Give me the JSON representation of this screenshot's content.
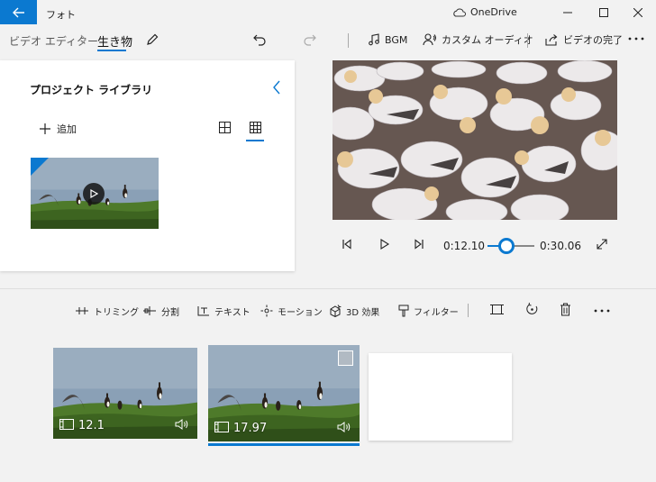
{
  "window": {
    "app_title": "フォト",
    "cloud_label": "OneDrive"
  },
  "toolbar": {
    "breadcrumb_root": "ビデオ エディター",
    "breadcrumb_current": "生き物",
    "bgm_label": "BGM",
    "custom_audio_label": "カスタム オーディオ",
    "finish_video_label": "ビデオの完了"
  },
  "library": {
    "title": "プロジェクト ライブラリ",
    "add_label": "追加"
  },
  "player": {
    "current_time": "0:12.10",
    "total_time": "0:30.06",
    "progress_fraction": 0.4
  },
  "storyboard": {
    "actions": [
      {
        "icon": "trim-icon",
        "label": "トリミング"
      },
      {
        "icon": "split-icon",
        "label": "分割"
      },
      {
        "icon": "text-icon",
        "label": "テキスト"
      },
      {
        "icon": "motion-icon",
        "label": "モーション"
      },
      {
        "icon": "3d-effects-icon",
        "label": "3D 効果"
      },
      {
        "icon": "filter-icon",
        "label": "フィルター"
      }
    ],
    "clips": [
      {
        "duration": "12.1"
      },
      {
        "duration": "17.97"
      }
    ]
  },
  "colors": {
    "accent": "#0b79d0",
    "background": "#f2f2f2",
    "panel": "#ffffff"
  }
}
